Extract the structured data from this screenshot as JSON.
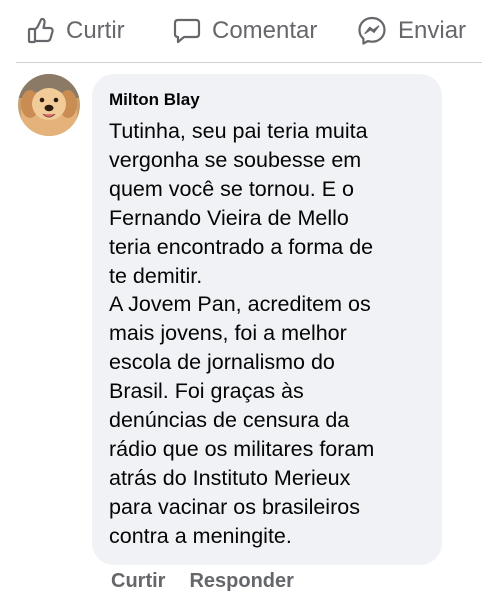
{
  "actions": {
    "like_label": "Curtir",
    "comment_label": "Comentar",
    "share_label": "Enviar"
  },
  "comment": {
    "author": "Milton Blay",
    "text_lines": [
      "Tutinha, seu pai teria muita",
      "vergonha se soubesse em",
      "quem você se tornou. E o",
      "Fernando Vieira de Mello",
      "teria encontrado a forma de",
      "te demitir.",
      "A Jovem Pan, acreditem os",
      "mais jovens, foi a melhor",
      "escola de jornalismo do",
      "Brasil. Foi graças às",
      "denúncias de censura da",
      "rádio que os militares foram",
      "atrás do Instituto Merieux",
      "para vacinar os brasileiros",
      "contra a meningite."
    ],
    "like_label": "Curtir",
    "reply_label": "Responder"
  },
  "icons": {
    "like": "thumbs-up-icon",
    "comment": "speech-bubble-icon",
    "share": "messenger-icon",
    "avatar": "dog-avatar"
  },
  "colors": {
    "muted": "#65676b",
    "bubble": "#f0f2f5",
    "text": "#050505"
  }
}
